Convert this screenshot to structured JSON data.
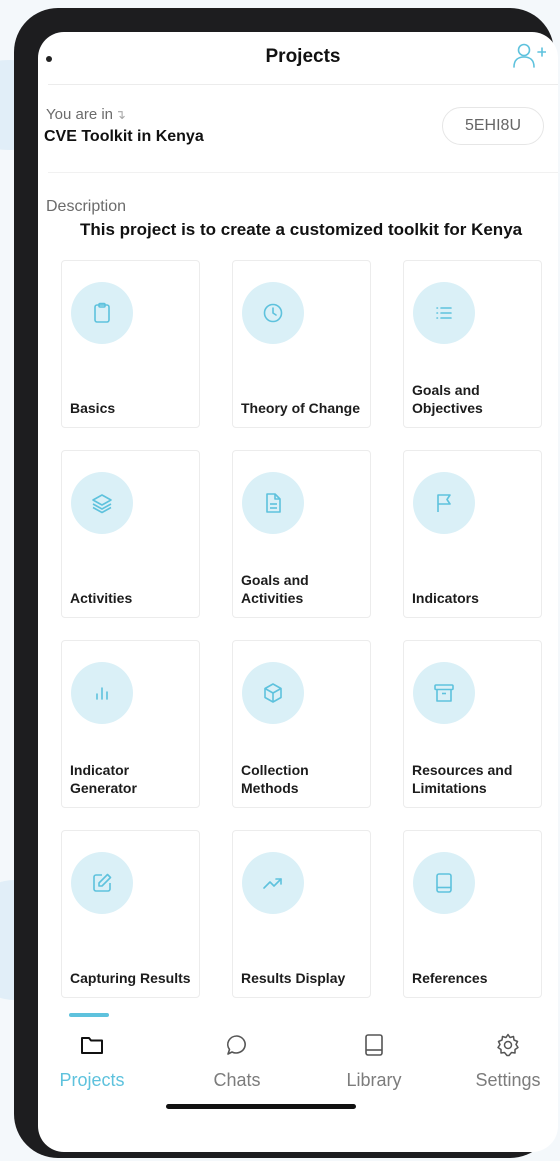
{
  "header": {
    "title": "Projects",
    "add_user_icon": "add-user-icon"
  },
  "project": {
    "you_are_in_label": "You are in",
    "name": "CVE Toolkit in Kenya",
    "code": "5EHI8U"
  },
  "description": {
    "label": "Description",
    "text": "This project is to create a customized toolkit for Kenya"
  },
  "tiles": [
    {
      "label": "Basics",
      "icon": "clipboard-icon"
    },
    {
      "label": "Theory of Change",
      "icon": "clock-icon"
    },
    {
      "label": "Goals and Objectives",
      "icon": "list-icon"
    },
    {
      "label": "Activities",
      "icon": "layers-icon"
    },
    {
      "label": "Goals and Activities",
      "icon": "document-icon"
    },
    {
      "label": "Indicators",
      "icon": "flag-icon"
    },
    {
      "label": "Indicator Generator",
      "icon": "bar-chart-icon"
    },
    {
      "label": "Collection Methods",
      "icon": "package-icon"
    },
    {
      "label": "Resources and Limitations",
      "icon": "archive-icon"
    },
    {
      "label": "Capturing Results",
      "icon": "edit-icon"
    },
    {
      "label": "Results Display",
      "icon": "trending-up-icon"
    },
    {
      "label": "References",
      "icon": "book-icon"
    }
  ],
  "nav": [
    {
      "label": "Projects",
      "icon": "folder-icon",
      "active": true
    },
    {
      "label": "Chats",
      "icon": "chat-bubble-icon",
      "active": false
    },
    {
      "label": "Library",
      "icon": "book-icon",
      "active": false
    },
    {
      "label": "Settings",
      "icon": "gear-icon",
      "active": false
    }
  ],
  "colors": {
    "accent": "#5ec2dd",
    "icon_bg": "#daf0f7"
  }
}
